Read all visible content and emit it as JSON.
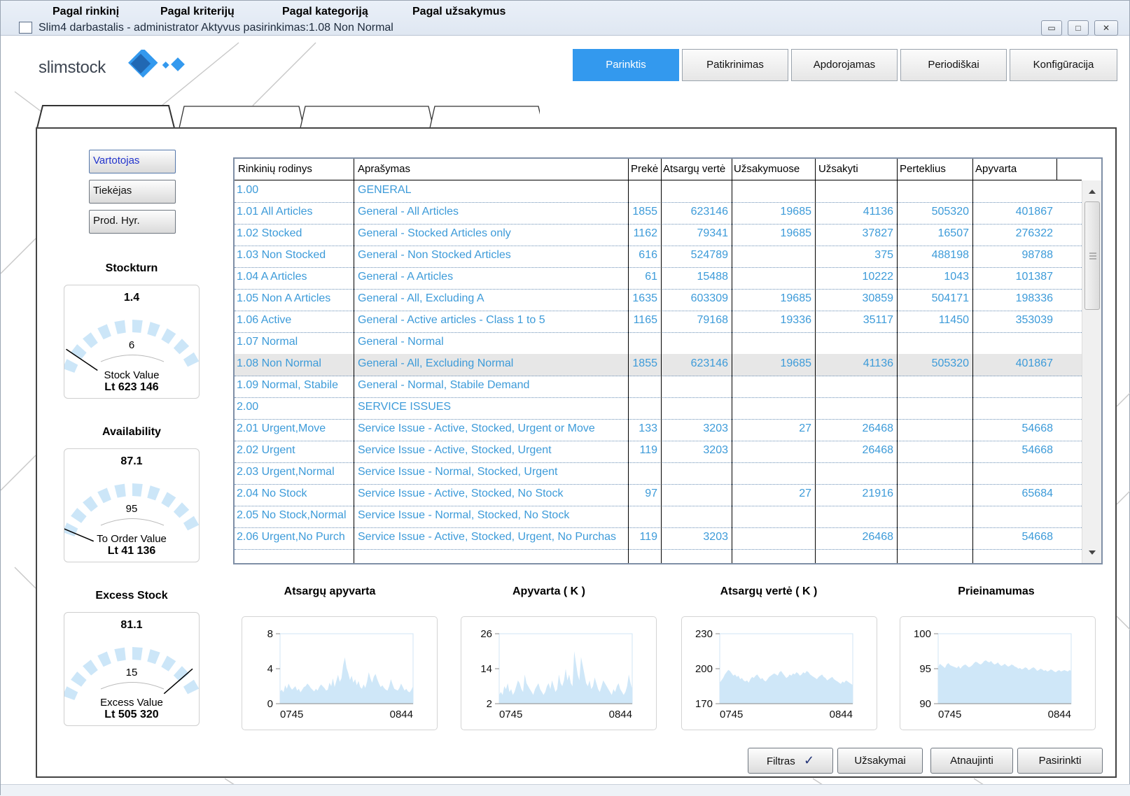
{
  "window": {
    "title": "Slim4 darbastalis - administrator Aktyvus pasirinkimas:1.08 Non Normal",
    "buttons": {
      "minimize": "▭",
      "maximize": "□",
      "close": "✕"
    }
  },
  "logo": {
    "text": "slimstock"
  },
  "topnav": [
    {
      "label": "Parinktis",
      "active": true
    },
    {
      "label": "Patikrinimas",
      "active": false
    },
    {
      "label": "Apdorojamas",
      "active": false
    },
    {
      "label": "Periodiškai",
      "active": false
    },
    {
      "label": "Konfigūracija",
      "active": false
    }
  ],
  "tabs": [
    "Pagal rinkinį",
    "Pagal kriterijų",
    "Pagal kategoriją",
    "Pagal užsakymus"
  ],
  "side_buttons": [
    "Vartotojas",
    "Tiekėjas",
    "Prod. Hyr."
  ],
  "gauges": [
    {
      "title": "Stockturn",
      "value": "1.4",
      "mid": "6",
      "caption": "Stock Value",
      "amount": "Lt 623 146",
      "level": 0.1
    },
    {
      "title": "Availability",
      "value": "87.1",
      "mid": "95",
      "caption": "To Order Value",
      "amount": "Lt 41 136",
      "level": 0.02
    },
    {
      "title": "Excess Stock",
      "value": "81.1",
      "mid": "15",
      "caption": "Excess Value",
      "amount": "Lt 505 320",
      "level": 0.85
    }
  ],
  "grid": {
    "columns": [
      "Rinkinių rodinys",
      "Aprašymas",
      "Prekė",
      "Atsargų vertė",
      "Užsakymuose",
      "Užsakyti",
      "Perteklius",
      "Apyvarta"
    ],
    "rows": [
      [
        "1.00",
        "GENERAL",
        "",
        "",
        "",
        "",
        "",
        ""
      ],
      [
        "1.01 All Articles",
        "General - All Articles",
        "1855",
        "623146",
        "19685",
        "41136",
        "505320",
        "401867"
      ],
      [
        "1.02 Stocked",
        "General - Stocked Articles only",
        "1162",
        "79341",
        "19685",
        "37827",
        "16507",
        "276322"
      ],
      [
        "1.03 Non Stocked",
        "General - Non Stocked Articles",
        "616",
        "524789",
        "",
        "375",
        "488198",
        "98788"
      ],
      [
        "1.04 A Articles",
        "General - A Articles",
        "61",
        "15488",
        "",
        "10222",
        "1043",
        "101387"
      ],
      [
        "1.05 Non A Articles",
        "General - All, Excluding A",
        "1635",
        "603309",
        "19685",
        "30859",
        "504171",
        "198336"
      ],
      [
        "1.06 Active",
        "General - Active articles - Class 1 to 5",
        "1165",
        "79168",
        "19336",
        "35117",
        "11450",
        "353039"
      ],
      [
        "1.07 Normal",
        "General - Normal",
        "",
        "",
        "",
        "",
        "",
        ""
      ],
      [
        "1.08 Non Normal",
        "General - All, Excluding Normal",
        "1855",
        "623146",
        "19685",
        "41136",
        "505320",
        "401867"
      ],
      [
        "1.09 Normal, Stabile",
        "General - Normal, Stabile Demand",
        "",
        "",
        "",
        "",
        "",
        ""
      ],
      [
        "2.00",
        "SERVICE ISSUES",
        "",
        "",
        "",
        "",
        "",
        ""
      ],
      [
        "2.01 Urgent,Move",
        "Service Issue - Active, Stocked, Urgent or Move",
        "133",
        "3203",
        "27",
        "26468",
        "",
        "54668"
      ],
      [
        "2.02 Urgent",
        "Service Issue - Active, Stocked, Urgent",
        "119",
        "3203",
        "",
        "26468",
        "",
        "54668"
      ],
      [
        "2.03 Urgent,Normal",
        "Service Issue - Normal, Stocked, Urgent",
        "",
        "",
        "",
        "",
        "",
        ""
      ],
      [
        "2.04 No Stock",
        "Service Issue - Active, Stocked, No Stock",
        "97",
        "",
        "27",
        "21916",
        "",
        "65684"
      ],
      [
        "2.05 No Stock,Normal",
        "Service Issue - Normal, Stocked, No Stock",
        "",
        "",
        "",
        "",
        "",
        ""
      ],
      [
        "2.06 Urgent,No Purch",
        "Service Issue - Active, Stocked, Urgent, No Purchas",
        "119",
        "3203",
        "",
        "26468",
        "",
        "54668"
      ]
    ],
    "selected_row": 8
  },
  "chart_data": [
    {
      "type": "area",
      "title": "Atsargų apyvarta",
      "x": [
        "0745",
        "0844"
      ],
      "ylim": [
        0,
        8
      ],
      "yticks": [
        "8",
        "4",
        "0"
      ],
      "values": [
        1.4,
        1.6,
        1.3,
        2.1,
        1.7,
        2.3,
        1.9,
        1.6,
        1.8,
        2.0,
        1.5,
        1.7,
        1.3,
        1.6,
        1.9,
        2.0,
        2.3,
        2.1,
        1.8,
        1.6,
        1.4,
        1.7,
        1.5,
        1.9,
        2.2,
        2.0,
        1.8,
        1.5,
        1.6,
        2.4,
        2.0,
        2.9,
        1.9,
        2.6,
        3.3,
        2.5,
        2.9,
        4.4,
        5.3,
        4.1,
        3.5,
        2.7,
        3.2,
        2.4,
        2.8,
        2.1,
        2.6,
        1.9,
        1.7,
        2.2,
        1.8,
        2.5,
        3.6,
        2.9,
        2.4,
        3.1,
        3.4,
        2.8,
        2.3,
        1.9,
        2.1,
        1.8,
        1.6,
        1.5,
        2.0,
        2.8,
        2.2,
        1.7,
        1.6,
        1.5,
        1.8,
        2.3,
        1.9,
        1.5,
        1.7,
        1.4,
        1.3,
        1.6,
        2.0
      ]
    },
    {
      "type": "area",
      "title": "Apyvarta ( K )",
      "x": [
        "0745",
        "0844"
      ],
      "ylim": [
        2,
        26
      ],
      "yticks": [
        "26",
        "14",
        "2"
      ],
      "values": [
        5,
        6,
        5,
        8,
        7,
        9,
        6,
        7,
        5,
        6,
        8,
        10,
        9,
        7,
        6,
        12,
        9,
        8,
        7,
        6,
        5,
        7,
        8,
        9,
        7,
        6,
        5,
        6,
        8,
        9,
        7,
        10,
        8,
        6,
        7,
        12,
        9,
        8,
        10,
        14,
        10,
        12,
        9,
        8,
        20,
        16,
        12,
        10,
        18,
        15,
        12,
        9,
        8,
        10,
        7,
        8,
        11,
        9,
        7,
        6,
        8,
        10,
        9,
        8,
        7,
        6,
        5,
        7,
        6,
        8,
        9,
        7,
        6,
        5,
        6,
        8,
        12,
        9,
        7
      ]
    },
    {
      "type": "area",
      "title": "Atsargų vertė ( K )",
      "x": [
        "0745",
        "0844"
      ],
      "ylim": [
        170,
        230
      ],
      "yticks": [
        "230",
        "200",
        "170"
      ],
      "values": [
        188,
        190,
        192,
        195,
        197,
        199,
        198,
        196,
        194,
        195,
        193,
        194,
        191,
        192,
        190,
        189,
        190,
        188,
        191,
        193,
        192,
        194,
        195,
        193,
        191,
        192,
        190,
        189,
        191,
        193,
        194,
        195,
        196,
        195,
        194,
        197,
        198,
        196,
        194,
        192,
        193,
        195,
        194,
        196,
        195,
        197,
        196,
        194,
        195,
        197,
        196,
        198,
        197,
        195,
        194,
        193,
        192,
        191,
        193,
        194,
        195,
        193,
        192,
        190,
        191,
        192,
        193,
        191,
        190,
        189,
        188,
        187,
        189,
        188,
        190,
        189,
        188,
        187,
        186
      ]
    },
    {
      "type": "area",
      "title": "Prieinamumas",
      "x": [
        "0745",
        "0844"
      ],
      "ylim": [
        90,
        100
      ],
      "yticks": [
        "100",
        "95",
        "90"
      ],
      "values": [
        95.2,
        95.7,
        95.5,
        95.3,
        95.1,
        95.6,
        95.8,
        95.5,
        95.4,
        95.3,
        95.2,
        95.1,
        95.4,
        95.0,
        95.3,
        95.5,
        95.6,
        95.4,
        95.2,
        95.3,
        95.5,
        95.8,
        96.0,
        95.9,
        95.7,
        95.6,
        95.8,
        96.1,
        96.2,
        96.0,
        95.9,
        96.1,
        95.8,
        95.6,
        95.7,
        95.9,
        95.6,
        95.4,
        95.5,
        95.7,
        95.5,
        95.3,
        95.4,
        95.6,
        95.5,
        95.3,
        95.2,
        95.0,
        95.1,
        94.9,
        95.0,
        95.2,
        95.1,
        94.8,
        94.9,
        95.1,
        95.2,
        95.0,
        94.7,
        94.8,
        95.0,
        94.9,
        94.7,
        94.8,
        94.6,
        94.7,
        94.9,
        94.8,
        94.6,
        94.5,
        94.7,
        94.8,
        94.6,
        94.7,
        94.8,
        94.7,
        94.6,
        94.8,
        94.7
      ]
    }
  ],
  "bottom_buttons": {
    "filter": "Filtras",
    "filter_mark": "✓",
    "orders": "Užsakymai",
    "refresh": "Atnaujinti",
    "select": "Pasirinkti"
  },
  "colors": {
    "accent": "#3399ee",
    "row_text": "#3d9bd9",
    "chart_fill": "#cfe7f8",
    "gauge_segments": "#cce6f8"
  }
}
